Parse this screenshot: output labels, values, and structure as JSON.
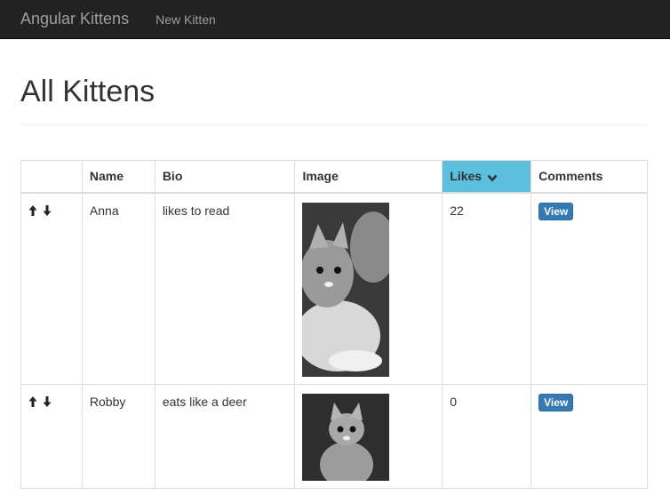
{
  "navbar": {
    "brand": "Angular Kittens",
    "links": [
      "New Kitten"
    ]
  },
  "page": {
    "title": "All Kittens"
  },
  "table": {
    "columns": [
      "",
      "Name",
      "Bio",
      "Image",
      "Likes",
      "Comments"
    ],
    "sorted_column": "Likes",
    "sort_direction": "descending",
    "rows": [
      {
        "name": "Anna",
        "bio": "likes to read",
        "image": "grayscale kitten photo",
        "likes": "22",
        "comments_button": "View"
      },
      {
        "name": "Robby",
        "bio": "eats like a deer",
        "image": "grayscale kitten photo",
        "likes": "0",
        "comments_button": "View"
      }
    ]
  },
  "colors": {
    "navbar_bg": "#222222",
    "nav_text": "#9d9d9d",
    "sorted_header": "#5bc0de",
    "button": "#337ab7"
  },
  "icons": {
    "move_up": "arrow-up-icon",
    "move_down": "arrow-down-icon",
    "sort": "chevron-down-icon"
  }
}
